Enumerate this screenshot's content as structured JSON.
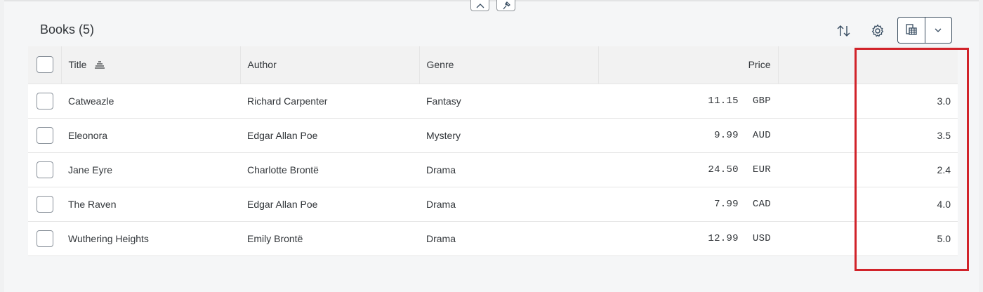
{
  "header": {
    "collapse_icon": "chevron-up-icon",
    "pin_icon": "pin-icon"
  },
  "toolbar": {
    "title": "Books (5)",
    "sort_icon": "sort-icon",
    "settings_icon": "gear-icon",
    "export_icon": "export-spreadsheet-icon",
    "dropdown_icon": "chevron-down-icon"
  },
  "table": {
    "columns": {
      "title": "Title",
      "author": "Author",
      "genre": "Genre",
      "price": "Price",
      "rating": ""
    },
    "rows": [
      {
        "title": "Catweazle",
        "author": "Richard Carpenter",
        "genre": "Fantasy",
        "price": "11.15",
        "currency": "GBP",
        "rating": "3.0"
      },
      {
        "title": "Eleonora",
        "author": "Edgar Allan Poe",
        "genre": "Mystery",
        "price": "9.99",
        "currency": "AUD",
        "rating": "3.5"
      },
      {
        "title": "Jane Eyre",
        "author": "Charlotte Brontë",
        "genre": "Drama",
        "price": "24.50",
        "currency": "EUR",
        "rating": "2.4"
      },
      {
        "title": "The Raven",
        "author": "Edgar Allan Poe",
        "genre": "Drama",
        "price": "7.99",
        "currency": "CAD",
        "rating": "4.0"
      },
      {
        "title": "Wuthering Heights",
        "author": "Emily Brontë",
        "genre": "Drama",
        "price": "12.99",
        "currency": "USD",
        "rating": "5.0"
      }
    ]
  },
  "colors": {
    "highlight": "#d1232a",
    "header_bg": "#f2f2f2",
    "page_bg": "#f5f6f7"
  }
}
